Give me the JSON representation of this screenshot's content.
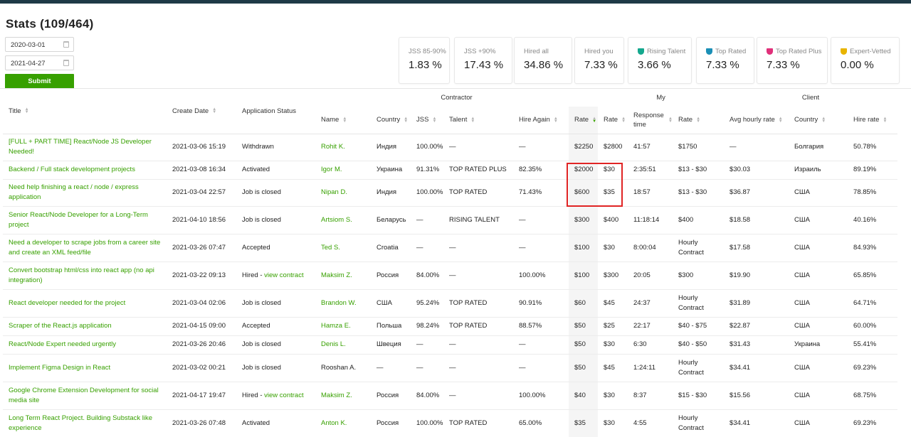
{
  "page": {
    "title": "Stats (109/464)"
  },
  "filters": {
    "date_from": "2020-03-01",
    "date_to": "2021-04-27",
    "submit_label": "Submit"
  },
  "stats": [
    {
      "label": "JSS 85-90%",
      "value": "1.83 %",
      "icon": "",
      "color": ""
    },
    {
      "label": "JSS +90%",
      "value": "17.43 %",
      "icon": "",
      "color": ""
    },
    {
      "label": "Hired all",
      "value": "34.86 %",
      "icon": "",
      "color": ""
    },
    {
      "label": "Hired you",
      "value": "7.33 %",
      "icon": "",
      "color": ""
    },
    {
      "label": "Rising Talent",
      "value": "3.66 %",
      "icon": "rising-talent-badge-icon",
      "color": "#14a88e"
    },
    {
      "label": "Top Rated",
      "value": "7.33 %",
      "icon": "top-rated-badge-icon",
      "color": "#1b8fb6"
    },
    {
      "label": "Top Rated Plus",
      "value": "7.33 %",
      "icon": "top-rated-plus-badge-icon",
      "color": "#e0307a"
    },
    {
      "label": "Expert-Vetted",
      "value": "0.00 %",
      "icon": "expert-vetted-badge-icon",
      "color": "#e8b400"
    }
  ],
  "table": {
    "groups": {
      "contractor": "Contractor",
      "my": "My",
      "client": "Client"
    },
    "headers": {
      "title": "Title",
      "create_date": "Create Date",
      "app_status": "Application Status",
      "name": "Name",
      "country": "Country",
      "jss": "JSS",
      "talent": "Talent",
      "hire_again": "Hire Again",
      "rate": "Rate",
      "my_rate": "Rate",
      "response_time": "Response time",
      "client_rate": "Rate",
      "avg_hourly_rate": "Avg hourly rate",
      "client_country": "Country",
      "hire_rate": "Hire rate"
    },
    "rows": [
      {
        "title": "[FULL + PART TIME] React/Node JS Developer Needed!",
        "date": "2021-03-06 15:19",
        "status": "Withdrawn",
        "contract_link": "",
        "name": "Rohit K.",
        "name_linked": true,
        "country": "Индия",
        "jss": "100.00%",
        "talent": "—",
        "hire_again": "—",
        "rate": "$2250",
        "my_rate": "$2800",
        "response": "41:57",
        "client_rate": "$1750",
        "avg_rate": "—",
        "client_country": "Болгария",
        "hire_rate": "50.78%"
      },
      {
        "title": "Backend / Full stack development projects",
        "date": "2021-03-08 16:34",
        "status": "Activated",
        "contract_link": "",
        "name": "Igor M.",
        "name_linked": true,
        "country": "Украина",
        "jss": "91.31%",
        "talent": "TOP RATED PLUS",
        "hire_again": "82.35%",
        "rate": "$2000",
        "my_rate": "$30",
        "response": "2:35:51",
        "client_rate": "$13 - $30",
        "avg_rate": "$30.03",
        "client_country": "Израиль",
        "hire_rate": "89.19%"
      },
      {
        "title": "Need help finishing a react / node / express application",
        "date": "2021-03-04 22:57",
        "status": "Job is closed",
        "contract_link": "",
        "name": "Nipan D.",
        "name_linked": true,
        "country": "Индия",
        "jss": "100.00%",
        "talent": "TOP RATED",
        "hire_again": "71.43%",
        "rate": "$600",
        "my_rate": "$35",
        "response": "18:57",
        "client_rate": "$13 - $30",
        "avg_rate": "$36.87",
        "client_country": "США",
        "hire_rate": "78.85%"
      },
      {
        "title": "Senior React/Node Developer for a Long-Term project",
        "date": "2021-04-10 18:56",
        "status": "Job is closed",
        "contract_link": "",
        "name": "Artsiom S.",
        "name_linked": true,
        "country": "Беларусь",
        "jss": "—",
        "talent": "RISING TALENT",
        "hire_again": "—",
        "rate": "$300",
        "my_rate": "$400",
        "response": "11:18:14",
        "client_rate": "$400",
        "avg_rate": "$18.58",
        "client_country": "США",
        "hire_rate": "40.16%"
      },
      {
        "title": "Need a developer to scrape jobs from a career site and create an XML feed/file",
        "date": "2021-03-26 07:47",
        "status": "Accepted",
        "contract_link": "",
        "name": "Ted S.",
        "name_linked": true,
        "country": "Croatia",
        "jss": "—",
        "talent": "—",
        "hire_again": "—",
        "rate": "$100",
        "my_rate": "$30",
        "response": "8:00:04",
        "client_rate": "Hourly Contract",
        "avg_rate": "$17.58",
        "client_country": "США",
        "hire_rate": "84.93%"
      },
      {
        "title": "Convert bootstrap html/css into react app (no api integration)",
        "date": "2021-03-22 09:13",
        "status": "Hired",
        "contract_link": "view contract",
        "name": "Maksim Z.",
        "name_linked": true,
        "country": "Россия",
        "jss": "84.00%",
        "talent": "—",
        "hire_again": "100.00%",
        "rate": "$100",
        "my_rate": "$300",
        "response": "20:05",
        "client_rate": "$300",
        "avg_rate": "$19.90",
        "client_country": "США",
        "hire_rate": "65.85%"
      },
      {
        "title": "React developer needed for the project",
        "date": "2021-03-04 02:06",
        "status": "Job is closed",
        "contract_link": "",
        "name": "Brandon W.",
        "name_linked": true,
        "country": "США",
        "jss": "95.24%",
        "talent": "TOP RATED",
        "hire_again": "90.91%",
        "rate": "$60",
        "my_rate": "$45",
        "response": "24:37",
        "client_rate": "Hourly Contract",
        "avg_rate": "$31.89",
        "client_country": "США",
        "hire_rate": "64.71%"
      },
      {
        "title": "Scraper of the React.js application",
        "date": "2021-04-15 09:00",
        "status": "Accepted",
        "contract_link": "",
        "name": "Hamza E.",
        "name_linked": true,
        "country": "Польша",
        "jss": "98.24%",
        "talent": "TOP RATED",
        "hire_again": "88.57%",
        "rate": "$50",
        "my_rate": "$25",
        "response": "22:17",
        "client_rate": "$40 - $75",
        "avg_rate": "$22.87",
        "client_country": "США",
        "hire_rate": "60.00%"
      },
      {
        "title": "React/Node Expert needed urgently",
        "date": "2021-03-26 20:46",
        "status": "Job is closed",
        "contract_link": "",
        "name": "Denis L.",
        "name_linked": true,
        "country": "Швеция",
        "jss": "—",
        "talent": "—",
        "hire_again": "—",
        "rate": "$50",
        "my_rate": "$30",
        "response": "6:30",
        "client_rate": "$40 - $50",
        "avg_rate": "$31.43",
        "client_country": "Украина",
        "hire_rate": "55.41%"
      },
      {
        "title": "Implement Figma Design in React",
        "date": "2021-03-02 00:21",
        "status": "Job is closed",
        "contract_link": "",
        "name": "Rooshan A.",
        "name_linked": false,
        "country": "—",
        "jss": "—",
        "talent": "—",
        "hire_again": "—",
        "rate": "$50",
        "my_rate": "$45",
        "response": "1:24:11",
        "client_rate": "Hourly Contract",
        "avg_rate": "$34.41",
        "client_country": "США",
        "hire_rate": "69.23%"
      },
      {
        "title": "Google Chrome Extension Development for social media site",
        "date": "2021-04-17 19:47",
        "status": "Hired",
        "contract_link": "view contract",
        "name": "Maksim Z.",
        "name_linked": true,
        "country": "Россия",
        "jss": "84.00%",
        "talent": "—",
        "hire_again": "100.00%",
        "rate": "$40",
        "my_rate": "$30",
        "response": "8:37",
        "client_rate": "$15 - $30",
        "avg_rate": "$15.56",
        "client_country": "США",
        "hire_rate": "68.75%"
      },
      {
        "title": "Long Term React Project. Building Substack like experience",
        "date": "2021-03-26 07:48",
        "status": "Activated",
        "contract_link": "",
        "name": "Anton K.",
        "name_linked": true,
        "country": "Россия",
        "jss": "100.00%",
        "talent": "TOP RATED",
        "hire_again": "65.00%",
        "rate": "$35",
        "my_rate": "$30",
        "response": "4:55",
        "client_rate": "Hourly Contract",
        "avg_rate": "$34.41",
        "client_country": "США",
        "hire_rate": "69.23%"
      }
    ]
  }
}
